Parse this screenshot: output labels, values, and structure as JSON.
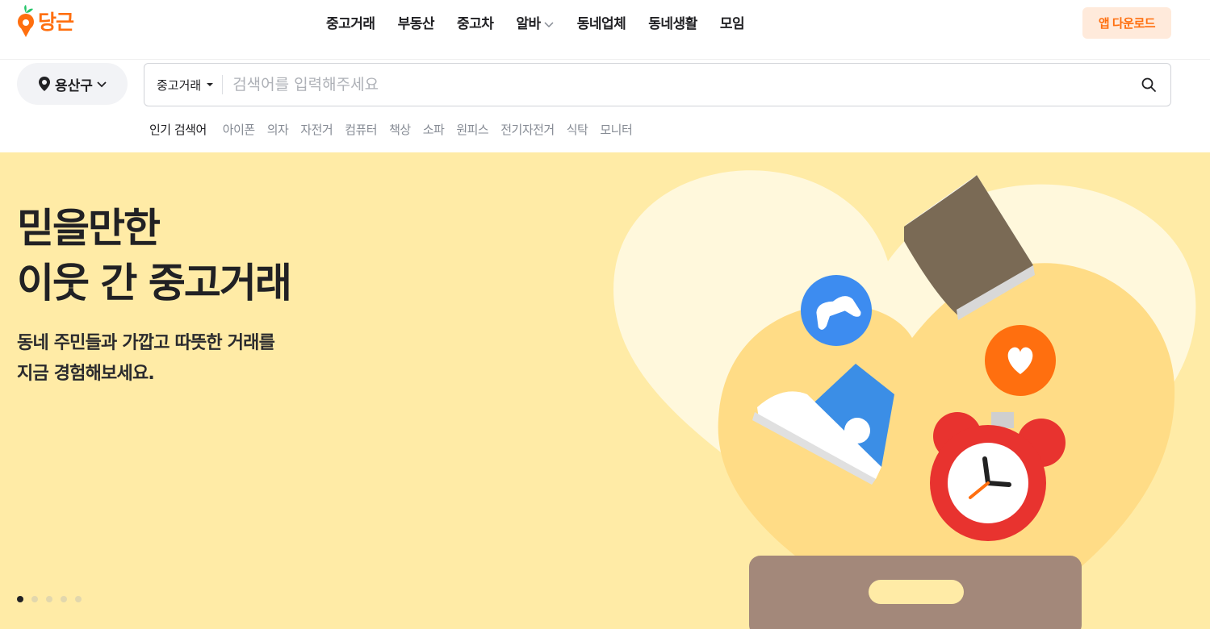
{
  "header": {
    "logo_text": "당근",
    "nav": [
      {
        "label": "중고거래"
      },
      {
        "label": "부동산"
      },
      {
        "label": "중고차"
      },
      {
        "label": "알바",
        "has_dropdown": true
      },
      {
        "label": "동네업체"
      },
      {
        "label": "동네생활"
      },
      {
        "label": "모임"
      }
    ],
    "app_download": "앱 다운로드"
  },
  "search": {
    "location": "용산구",
    "category": "중고거래",
    "placeholder": "검색어를 입력해주세요",
    "value": ""
  },
  "popular": {
    "label": "인기 검색어",
    "keywords": [
      "아이폰",
      "의자",
      "자전거",
      "컴퓨터",
      "책상",
      "소파",
      "원피스",
      "전기자전거",
      "식탁",
      "모니터"
    ]
  },
  "hero": {
    "title_line1": "믿을만한",
    "title_line2": "이웃 간 중고거래",
    "subtitle_line1": "동네 주민들과 가깝고 따뜻한 거래를",
    "subtitle_line2": "지금 경험해보세요.",
    "slide_count": 5,
    "active_slide": 1
  },
  "colors": {
    "brand": "#ff6f0f",
    "hero_bg": "#ffeba6",
    "app_button_bg": "#ffeadb"
  }
}
